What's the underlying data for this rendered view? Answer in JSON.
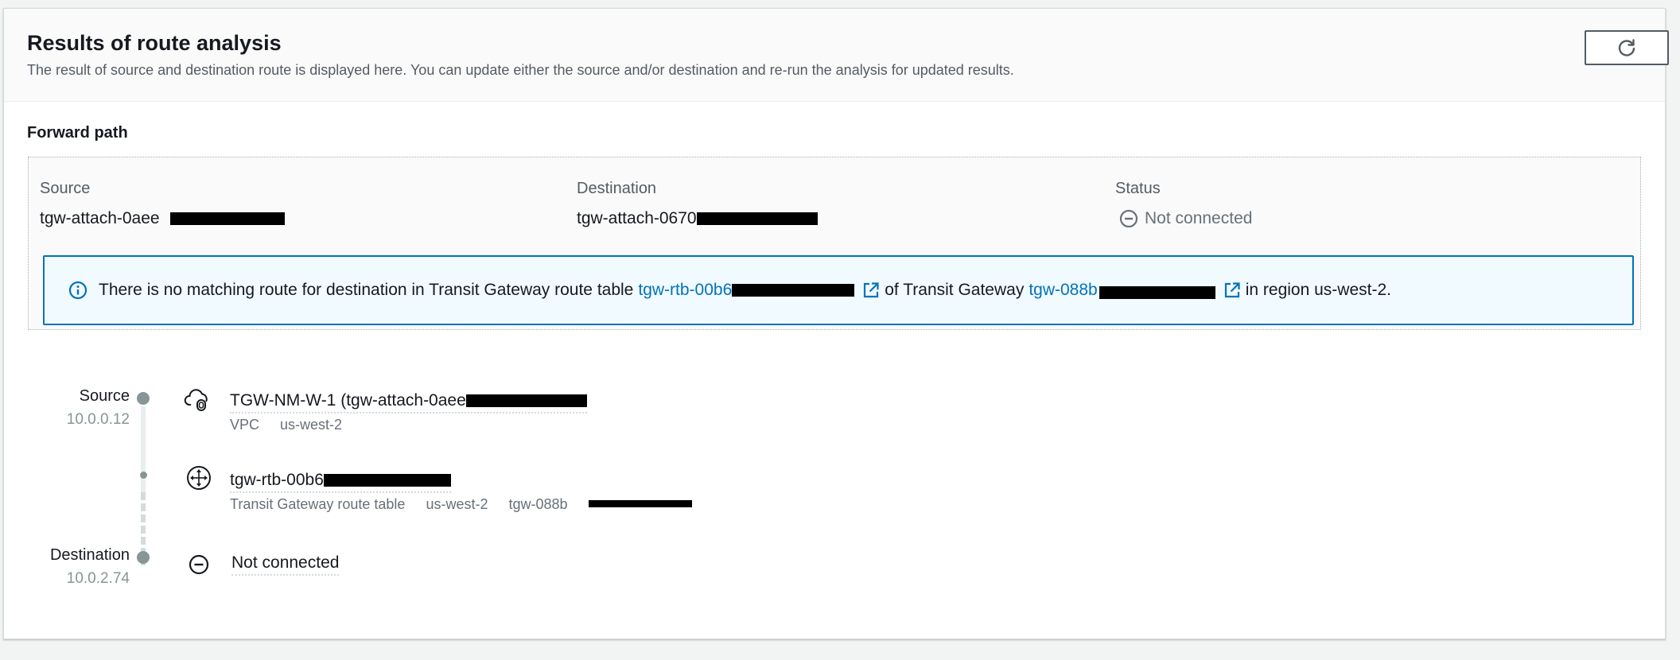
{
  "header": {
    "title": "Results of route analysis",
    "description": "The result of source and destination route is displayed here. You can update either the source and/or destination and re-run the analysis for updated results.",
    "refresh_icon": "refresh-icon"
  },
  "forward_path": {
    "title": "Forward path",
    "source_label": "Source",
    "source_value": "tgw-attach-0aee",
    "destination_label": "Destination",
    "destination_value": "tgw-attach-0670",
    "status_label": "Status",
    "status_value": "Not connected",
    "status_icon": "minus-circle-icon"
  },
  "alert": {
    "icon": "info-icon",
    "text_1": "There is no matching route for destination in Transit Gateway route table",
    "rtb_link": "tgw-rtb-00b6",
    "text_2": "of Transit Gateway",
    "tgw_link": "tgw-088b",
    "text_3": "in region us-west-2."
  },
  "route": {
    "source_label": "Source",
    "source_ip": "10.0.0.12",
    "destination_label": "Destination",
    "destination_ip": "10.0.2.74",
    "nodes": [
      {
        "icon": "vpc-cloud-icon",
        "title": "TGW-NM-W-1 (tgw-attach-0aee",
        "type": "VPC",
        "region": "us-west-2"
      },
      {
        "icon": "route-table-icon",
        "title": "tgw-rtb-00b6",
        "type": "Transit Gateway route table",
        "region": "us-west-2",
        "gateway": "tgw-088b"
      },
      {
        "icon": "minus-circle-icon",
        "title": "Not connected"
      }
    ]
  }
}
